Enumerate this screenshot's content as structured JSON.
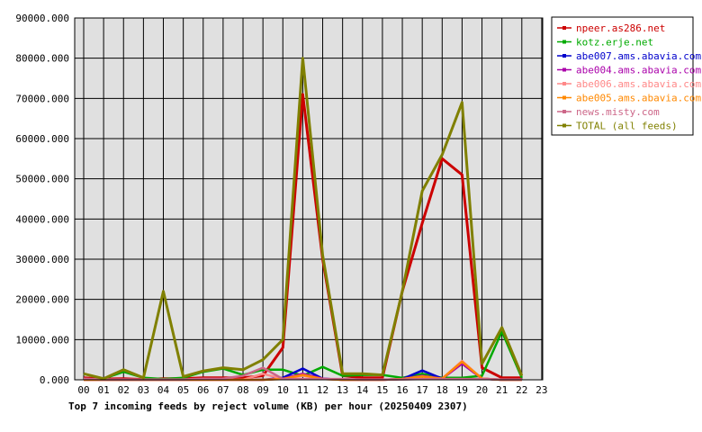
{
  "chart_data": {
    "type": "line",
    "title": "Top 7 incoming feeds by reject volume (KB) per hour (20250409 2307)",
    "xlabel": "",
    "ylabel": "",
    "categories": [
      "00",
      "01",
      "02",
      "03",
      "04",
      "05",
      "06",
      "07",
      "08",
      "09",
      "10",
      "11",
      "12",
      "13",
      "14",
      "15",
      "16",
      "17",
      "18",
      "19",
      "20",
      "21",
      "22",
      "23"
    ],
    "ylim": [
      0,
      90000
    ],
    "yticks": [
      "0.000",
      "10000.000",
      "20000.000",
      "30000.000",
      "40000.000",
      "50000.000",
      "60000.000",
      "70000.000",
      "80000.000",
      "90000.000"
    ],
    "grid": true,
    "legend_position": "right",
    "series": [
      {
        "name": "npeer.as286.net",
        "color": "#cc0000",
        "values": [
          500,
          200,
          300,
          100,
          300,
          300,
          500,
          500,
          500,
          1000,
          8000,
          71000,
          30000,
          1000,
          500,
          500,
          22000,
          39000,
          55000,
          51000,
          3000,
          500,
          500,
          null
        ]
      },
      {
        "name": "kotz.erje.net",
        "color": "#00aa00",
        "values": [
          1500,
          300,
          2000,
          500,
          200,
          500,
          2000,
          2800,
          1200,
          2500,
          2500,
          1000,
          3200,
          1000,
          1200,
          1200,
          500,
          1500,
          500,
          500,
          1000,
          12000,
          500,
          null
        ]
      },
      {
        "name": "abe007.ams.abavia.com",
        "color": "#0000cc",
        "values": [
          0,
          0,
          0,
          0,
          0,
          0,
          0,
          0,
          0,
          0,
          500,
          2800,
          300,
          0,
          0,
          0,
          200,
          2300,
          300,
          4500,
          300,
          0,
          0,
          null
        ]
      },
      {
        "name": "abe004.ams.abavia.com",
        "color": "#aa00aa",
        "values": [
          0,
          0,
          0,
          0,
          0,
          0,
          0,
          0,
          0,
          0,
          300,
          1500,
          300,
          0,
          0,
          0,
          200,
          1000,
          300,
          4000,
          300,
          0,
          0,
          null
        ]
      },
      {
        "name": "abe006.ams.abavia.com",
        "color": "#ff8888",
        "values": [
          0,
          0,
          0,
          0,
          0,
          0,
          0,
          0,
          0,
          1500,
          200,
          1000,
          200,
          0,
          0,
          0,
          200,
          800,
          300,
          4700,
          300,
          0,
          0,
          null
        ]
      },
      {
        "name": "abe005.ams.abavia.com",
        "color": "#ff8800",
        "values": [
          0,
          0,
          0,
          0,
          0,
          0,
          0,
          0,
          0,
          0,
          200,
          1200,
          200,
          0,
          0,
          0,
          200,
          800,
          300,
          4500,
          300,
          0,
          0,
          null
        ]
      },
      {
        "name": "news.misty.com",
        "color": "#cc6688",
        "values": [
          300,
          100,
          100,
          100,
          100,
          100,
          300,
          300,
          1000,
          3000,
          200,
          200,
          200,
          200,
          100,
          100,
          100,
          200,
          200,
          200,
          200,
          100,
          100,
          null
        ]
      },
      {
        "name": "TOTAL (all feeds)",
        "color": "#808000",
        "values": [
          1500,
          300,
          2500,
          500,
          22000,
          800,
          2200,
          3000,
          2500,
          5000,
          10000,
          80000,
          31000,
          1500,
          1500,
          1200,
          22000,
          47000,
          56000,
          69000,
          4000,
          13000,
          1000,
          null
        ]
      }
    ]
  }
}
